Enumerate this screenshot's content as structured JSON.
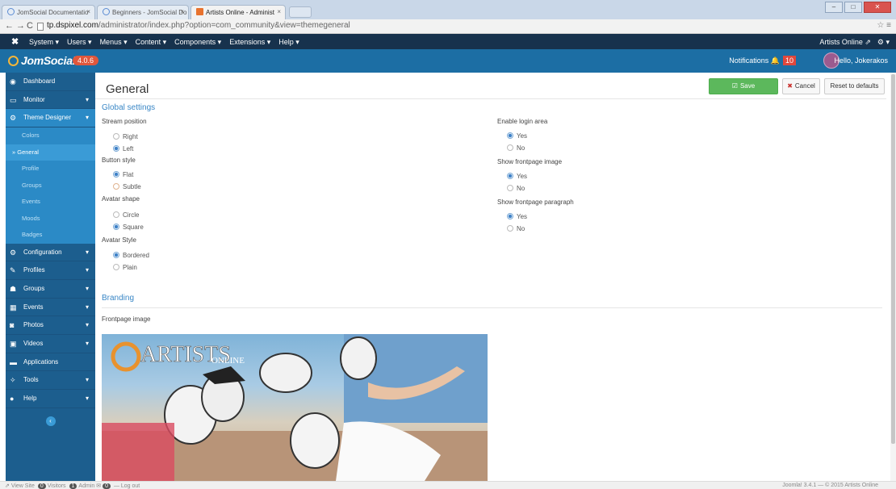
{
  "browser": {
    "tabs": [
      {
        "label": "JomSocial Documentatio"
      },
      {
        "label": "Beginners - JomSocial Do"
      },
      {
        "label": "Artists Online - Administ"
      }
    ],
    "url_host": "tp.dspixel.com",
    "url_path": "/administrator/index.php?option=com_community&view=themegeneral"
  },
  "sysbar": {
    "menus": [
      "System ▾",
      "Users ▾",
      "Menus ▾",
      "Content ▾",
      "Components ▾",
      "Extensions ▾",
      "Help ▾"
    ],
    "site_link": "Artists Online ⇗",
    "settings": "⚙ ▾"
  },
  "header": {
    "logo": "JomSocial",
    "version": "4.0.6",
    "notifications_label": "Notifications",
    "notifications_count": "10",
    "greeting": "Hello, Jokerakos"
  },
  "sidebar": {
    "items": [
      {
        "label": "Dashboard",
        "icon": "◉"
      },
      {
        "label": "Monitor",
        "icon": "▭",
        "chev": "▾"
      },
      {
        "label": "Theme Designer",
        "icon": "⚙",
        "chev": "▾"
      }
    ],
    "subitems": [
      {
        "label": "Colors"
      },
      {
        "label": "» General"
      },
      {
        "label": "Profile"
      },
      {
        "label": "Groups"
      },
      {
        "label": "Events"
      },
      {
        "label": "Moods"
      },
      {
        "label": "Badges"
      }
    ],
    "items2": [
      {
        "label": "Configuration",
        "icon": "⚙",
        "chev": "▾"
      },
      {
        "label": "Profiles",
        "icon": "✎",
        "chev": "▾"
      },
      {
        "label": "Groups",
        "icon": "☗",
        "chev": "▾"
      },
      {
        "label": "Events",
        "icon": "▦",
        "chev": "▾"
      },
      {
        "label": "Photos",
        "icon": "◙",
        "chev": "▾"
      },
      {
        "label": "Videos",
        "icon": "▣",
        "chev": "▾"
      },
      {
        "label": "Applications",
        "icon": "▬"
      },
      {
        "label": "Tools",
        "icon": "✧",
        "chev": "▾"
      },
      {
        "label": "Help",
        "icon": "●",
        "chev": "▾"
      }
    ],
    "collapse": "‹"
  },
  "page": {
    "title": "General",
    "save": "Save",
    "cancel": "Cancel",
    "reset": "Reset to defaults",
    "global_settings": "Global settings",
    "branding": "Branding",
    "frontpage_image_label": "Frontpage image",
    "image_text": "ARTISTS",
    "image_subtext": "ONLINE"
  },
  "settings_left": [
    {
      "label": "Stream position",
      "options": [
        {
          "text": "Right",
          "checked": false
        },
        {
          "text": "Left",
          "checked": true
        }
      ]
    },
    {
      "label": "Button style",
      "options": [
        {
          "text": "Flat",
          "checked": true
        },
        {
          "text": "Subtle",
          "checked": false
        }
      ]
    },
    {
      "label": "Avatar shape",
      "options": [
        {
          "text": "Circle",
          "checked": false
        },
        {
          "text": "Square",
          "checked": true
        }
      ]
    },
    {
      "label": "Avatar Style",
      "options": [
        {
          "text": "Bordered",
          "checked": true
        },
        {
          "text": "Plain",
          "checked": false
        }
      ]
    }
  ],
  "settings_right": [
    {
      "label": "Enable login area",
      "options": [
        {
          "text": "Yes",
          "checked": true
        },
        {
          "text": "No",
          "checked": false
        }
      ]
    },
    {
      "label": "Show frontpage image",
      "options": [
        {
          "text": "Yes",
          "checked": true
        },
        {
          "text": "No",
          "checked": false
        }
      ]
    },
    {
      "label": "Show frontpage paragraph",
      "options": [
        {
          "text": "Yes",
          "checked": true
        },
        {
          "text": "No",
          "checked": false
        }
      ]
    }
  ],
  "statusbar": {
    "view_site": "View Site",
    "visitors_count": "0",
    "visitors": "Visitors",
    "admin_count": "1",
    "admin": "Admin",
    "messages_count": "0",
    "logout": "Log out",
    "footer": "Joomla! 3.4.1 — © 2015 Artists Online"
  }
}
